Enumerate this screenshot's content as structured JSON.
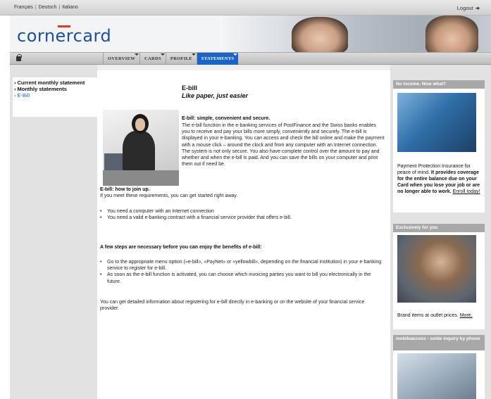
{
  "topbar": {
    "languages": [
      "Français",
      "Deutsch",
      "Italiano"
    ],
    "logout_label": "Logout",
    "logout_arrow": "➔"
  },
  "banner": {
    "logo_text": "cornercard"
  },
  "nav": {
    "tabs": [
      {
        "label": "OVERVIEW"
      },
      {
        "label": "CARDS"
      },
      {
        "label": "PROFILE"
      },
      {
        "label": "STATEMENTS"
      }
    ],
    "active_tab": "STATEMENTS"
  },
  "sidebar": {
    "items": [
      {
        "label": "Current monthly statement"
      },
      {
        "label": "Monthly statements"
      },
      {
        "label": "E-Bill"
      }
    ]
  },
  "main": {
    "title": "E-bill",
    "subtitle": "Like paper, just easier",
    "intro_heading": "E-bill: simple, convenient and secure.",
    "intro_body": "The e-bill function in the e-banking services of PostFinance and the Swiss banks enables you to receive and pay your bills more simply, conveniently and securely. The e-bill is displayed in your e-banking. You can access and check the bill online and make the payment with a mouse click – around the clock and from any computer with an Internet connection. The system is not only secure. You also have complete control over the amount to pay and whether and when the e-bill is paid. And you can save the bills on your computer and print them out if need be.",
    "join_heading": "E-bill: how to join up.",
    "join_body": "If you meet these requirements, you can get started right away.",
    "requirements": [
      "You need a computer with an Internet connection",
      "You need a valid e-banking contract with a financial service provider that offers e-bill."
    ],
    "steps_heading": "A few steps are necessary before you can enjoy the benefits of e-bill:",
    "steps": [
      "Go to the appropriate menu option («e-bill», «PayNet» or «yellowbill», depending on the financial institution) in your e-banking service to register for e-bill.",
      "As soon as the e-bill function is activated, you can choose which invoicing parties you want to bill you electronically in the future."
    ],
    "more_info": "You can get detailed information about registering for e-bill directly in e-banking or on the website of your financial service provider."
  },
  "right": {
    "box1": {
      "heading": "No income. Now what?",
      "text_plain": "Payment Protection Insurance for peace of mind. ",
      "text_bold": "It provides coverage for the entire balance due on your Card when you lose your job or are no longer able to work.",
      "link": "Enroll today!"
    },
    "box2": {
      "heading": "Exclusively for you",
      "text": "Brand items at outlet prices.",
      "link": "More."
    },
    "box3": {
      "heading": "mobileaccess - solde inquiry by phone"
    }
  }
}
